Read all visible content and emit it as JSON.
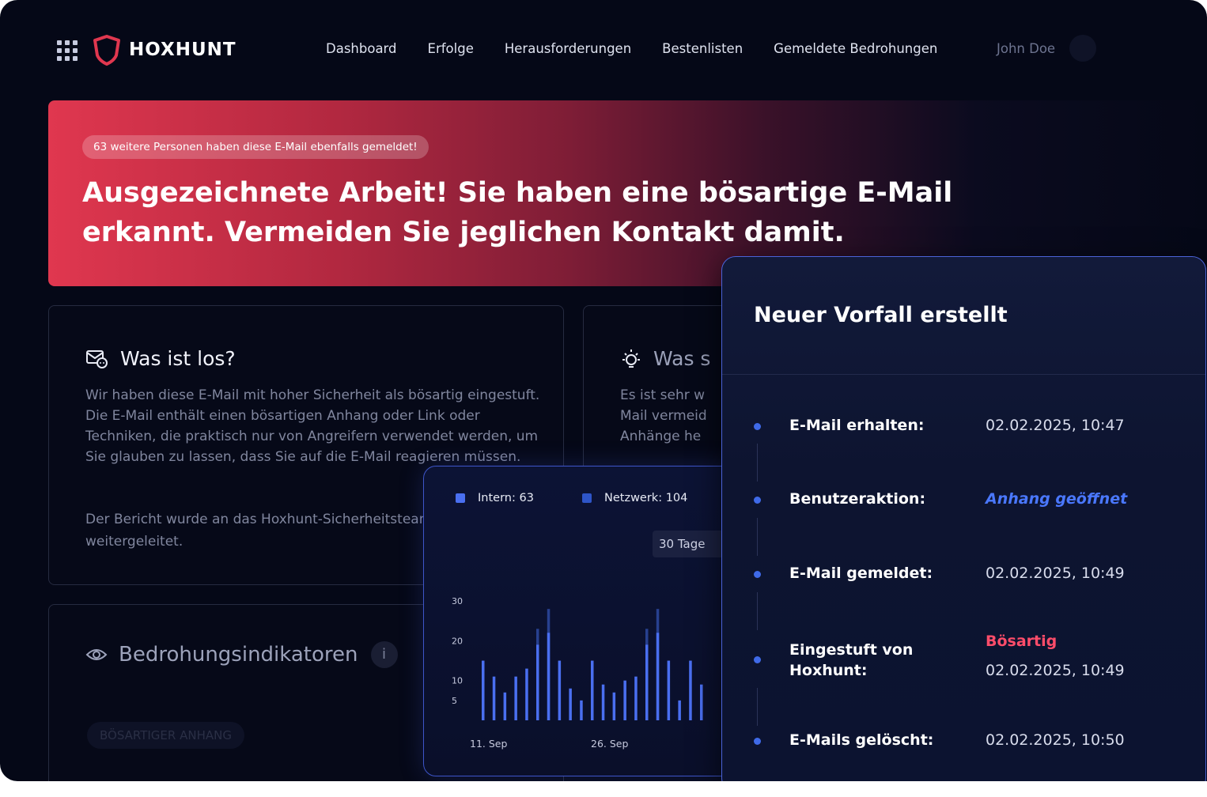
{
  "brand": {
    "name": "HOXHUNT",
    "accent": "#e0374f"
  },
  "nav": {
    "items": [
      "Dashboard",
      "Erfolge",
      "Herausforderungen",
      "Bestenlisten",
      "Gemeldete Bedrohungen"
    ],
    "user": "John Doe"
  },
  "hero": {
    "badge": "63 weitere Personen haben diese E-Mail ebenfalls gemeldet!",
    "title": "Ausgezeichnete Arbeit! Sie haben eine bösartige E-Mail erkannt. Vermeiden Sie jeglichen Kontakt damit."
  },
  "what_happened": {
    "title": "Was ist los?",
    "body1": "Wir haben diese E-Mail mit hoher Sicherheit als bösartig eingestuft. Die E-Mail enthält einen bösartigen Anhang oder Link oder Techniken, die praktisch nur von Angreifern verwendet werden, um Sie glauben zu lassen, dass Sie auf die E-Mail reagieren müssen.",
    "body2": "Der Bericht wurde an das Hoxhunt-Sicherheitsteam weitergeleitet."
  },
  "what_next": {
    "title": "Was s",
    "body": "Es ist sehr w Mail vermeid Anhänge he"
  },
  "indicators": {
    "title": "Bedrohungsindikatoren",
    "info": "i",
    "tag": "BÖSARTIGER ANHANG"
  },
  "chart_panel": {
    "legend_internal": "Intern: 63",
    "legend_network": "Netzwerk: 104",
    "range": "30 Tage"
  },
  "chart_data": {
    "type": "bar",
    "y_ticks": [
      "30",
      "20",
      "10",
      "5"
    ],
    "x_ticks": [
      "11. Sep",
      "26. Sep"
    ],
    "series": [
      {
        "values": [
          15,
          11,
          7,
          11,
          13,
          19,
          22,
          15,
          8,
          5,
          15,
          9,
          7,
          10,
          11,
          19,
          22,
          15,
          5,
          15,
          9
        ]
      },
      {
        "values": [
          0,
          0,
          0,
          0,
          0,
          23,
          28,
          0,
          0,
          0,
          0,
          0,
          0,
          0,
          0,
          23,
          28,
          0,
          0,
          0,
          0
        ]
      }
    ],
    "ylim": [
      0,
      33
    ]
  },
  "incident": {
    "title": "Neuer Vorfall erstellt",
    "events": [
      {
        "label": "E-Mail erhalten:",
        "value": "02.02.2025, 10:47"
      },
      {
        "label": "Benutzeraktion:",
        "value": "Anhang geöffnet"
      },
      {
        "label": "E-Mail gemeldet:",
        "value": "02.02.2025, 10:49"
      },
      {
        "label": "Eingestuft von Hoxhunt:",
        "status": "Bösartig",
        "value": "02.02.2025, 10:49"
      },
      {
        "label": "E-Mails gelöscht:",
        "value": "02.02.2025, 10:50"
      }
    ]
  }
}
